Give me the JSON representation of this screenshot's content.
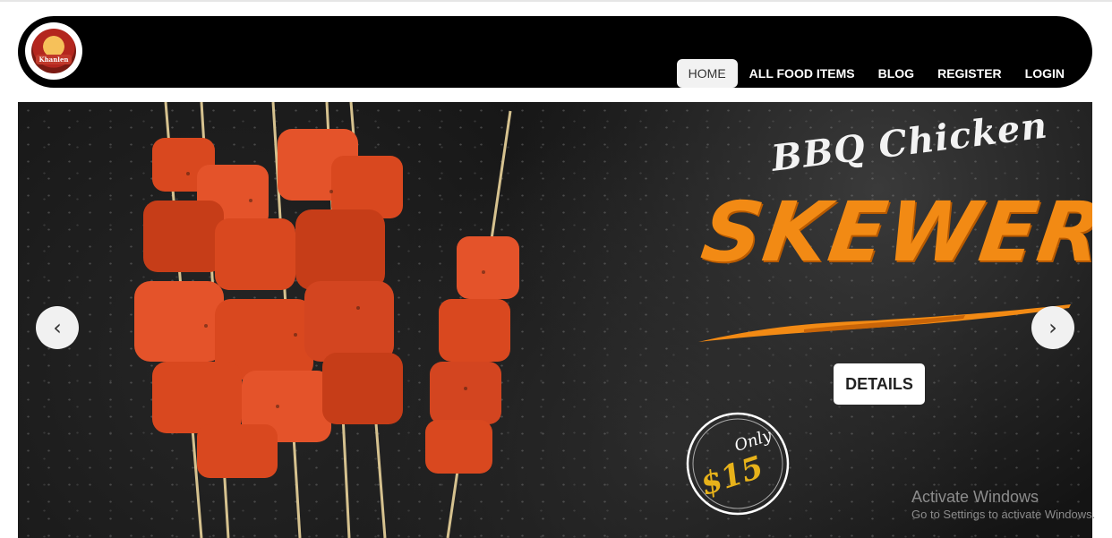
{
  "nav": {
    "logo_text": "Khanlen",
    "items": [
      {
        "label": "HOME",
        "active": true
      },
      {
        "label": "ALL FOOD ITEMS"
      },
      {
        "label": "BLOG"
      },
      {
        "label": "REGISTER"
      },
      {
        "label": "LOGIN"
      }
    ]
  },
  "hero": {
    "subtitle": "BBQ Chicken",
    "title": "SKEWER",
    "details_label": "DETAILS",
    "price_prefix": "Only",
    "price": "$15",
    "prev_glyph": "‹",
    "next_glyph": "›",
    "colors": {
      "title": "#f28a14",
      "price": "#e7b21a"
    }
  },
  "watermark": {
    "title": "Activate Windows",
    "subtitle": "Go to Settings to activate Windows."
  }
}
